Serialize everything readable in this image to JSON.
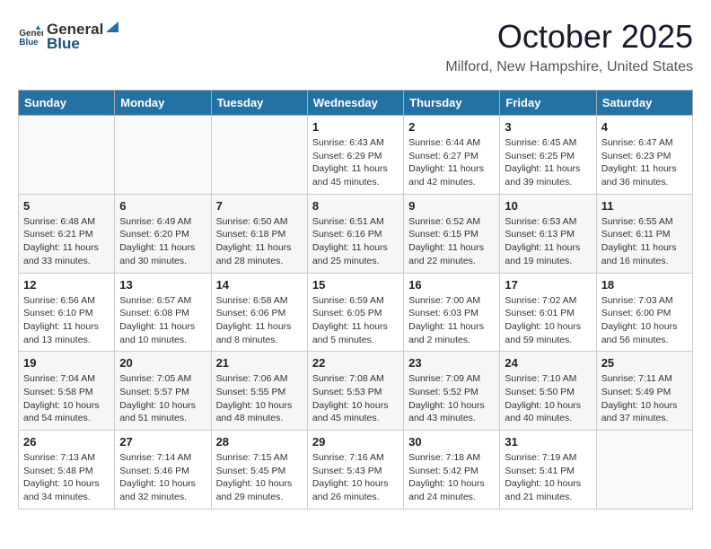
{
  "header": {
    "logo_general": "General",
    "logo_blue": "Blue",
    "month": "October 2025",
    "location": "Milford, New Hampshire, United States"
  },
  "weekdays": [
    "Sunday",
    "Monday",
    "Tuesday",
    "Wednesday",
    "Thursday",
    "Friday",
    "Saturday"
  ],
  "weeks": [
    [
      {
        "day": "",
        "info": ""
      },
      {
        "day": "",
        "info": ""
      },
      {
        "day": "",
        "info": ""
      },
      {
        "day": "1",
        "info": "Sunrise: 6:43 AM\nSunset: 6:29 PM\nDaylight: 11 hours and 45 minutes."
      },
      {
        "day": "2",
        "info": "Sunrise: 6:44 AM\nSunset: 6:27 PM\nDaylight: 11 hours and 42 minutes."
      },
      {
        "day": "3",
        "info": "Sunrise: 6:45 AM\nSunset: 6:25 PM\nDaylight: 11 hours and 39 minutes."
      },
      {
        "day": "4",
        "info": "Sunrise: 6:47 AM\nSunset: 6:23 PM\nDaylight: 11 hours and 36 minutes."
      }
    ],
    [
      {
        "day": "5",
        "info": "Sunrise: 6:48 AM\nSunset: 6:21 PM\nDaylight: 11 hours and 33 minutes."
      },
      {
        "day": "6",
        "info": "Sunrise: 6:49 AM\nSunset: 6:20 PM\nDaylight: 11 hours and 30 minutes."
      },
      {
        "day": "7",
        "info": "Sunrise: 6:50 AM\nSunset: 6:18 PM\nDaylight: 11 hours and 28 minutes."
      },
      {
        "day": "8",
        "info": "Sunrise: 6:51 AM\nSunset: 6:16 PM\nDaylight: 11 hours and 25 minutes."
      },
      {
        "day": "9",
        "info": "Sunrise: 6:52 AM\nSunset: 6:15 PM\nDaylight: 11 hours and 22 minutes."
      },
      {
        "day": "10",
        "info": "Sunrise: 6:53 AM\nSunset: 6:13 PM\nDaylight: 11 hours and 19 minutes."
      },
      {
        "day": "11",
        "info": "Sunrise: 6:55 AM\nSunset: 6:11 PM\nDaylight: 11 hours and 16 minutes."
      }
    ],
    [
      {
        "day": "12",
        "info": "Sunrise: 6:56 AM\nSunset: 6:10 PM\nDaylight: 11 hours and 13 minutes."
      },
      {
        "day": "13",
        "info": "Sunrise: 6:57 AM\nSunset: 6:08 PM\nDaylight: 11 hours and 10 minutes."
      },
      {
        "day": "14",
        "info": "Sunrise: 6:58 AM\nSunset: 6:06 PM\nDaylight: 11 hours and 8 minutes."
      },
      {
        "day": "15",
        "info": "Sunrise: 6:59 AM\nSunset: 6:05 PM\nDaylight: 11 hours and 5 minutes."
      },
      {
        "day": "16",
        "info": "Sunrise: 7:00 AM\nSunset: 6:03 PM\nDaylight: 11 hours and 2 minutes."
      },
      {
        "day": "17",
        "info": "Sunrise: 7:02 AM\nSunset: 6:01 PM\nDaylight: 10 hours and 59 minutes."
      },
      {
        "day": "18",
        "info": "Sunrise: 7:03 AM\nSunset: 6:00 PM\nDaylight: 10 hours and 56 minutes."
      }
    ],
    [
      {
        "day": "19",
        "info": "Sunrise: 7:04 AM\nSunset: 5:58 PM\nDaylight: 10 hours and 54 minutes."
      },
      {
        "day": "20",
        "info": "Sunrise: 7:05 AM\nSunset: 5:57 PM\nDaylight: 10 hours and 51 minutes."
      },
      {
        "day": "21",
        "info": "Sunrise: 7:06 AM\nSunset: 5:55 PM\nDaylight: 10 hours and 48 minutes."
      },
      {
        "day": "22",
        "info": "Sunrise: 7:08 AM\nSunset: 5:53 PM\nDaylight: 10 hours and 45 minutes."
      },
      {
        "day": "23",
        "info": "Sunrise: 7:09 AM\nSunset: 5:52 PM\nDaylight: 10 hours and 43 minutes."
      },
      {
        "day": "24",
        "info": "Sunrise: 7:10 AM\nSunset: 5:50 PM\nDaylight: 10 hours and 40 minutes."
      },
      {
        "day": "25",
        "info": "Sunrise: 7:11 AM\nSunset: 5:49 PM\nDaylight: 10 hours and 37 minutes."
      }
    ],
    [
      {
        "day": "26",
        "info": "Sunrise: 7:13 AM\nSunset: 5:48 PM\nDaylight: 10 hours and 34 minutes."
      },
      {
        "day": "27",
        "info": "Sunrise: 7:14 AM\nSunset: 5:46 PM\nDaylight: 10 hours and 32 minutes."
      },
      {
        "day": "28",
        "info": "Sunrise: 7:15 AM\nSunset: 5:45 PM\nDaylight: 10 hours and 29 minutes."
      },
      {
        "day": "29",
        "info": "Sunrise: 7:16 AM\nSunset: 5:43 PM\nDaylight: 10 hours and 26 minutes."
      },
      {
        "day": "30",
        "info": "Sunrise: 7:18 AM\nSunset: 5:42 PM\nDaylight: 10 hours and 24 minutes."
      },
      {
        "day": "31",
        "info": "Sunrise: 7:19 AM\nSunset: 5:41 PM\nDaylight: 10 hours and 21 minutes."
      },
      {
        "day": "",
        "info": ""
      }
    ]
  ]
}
